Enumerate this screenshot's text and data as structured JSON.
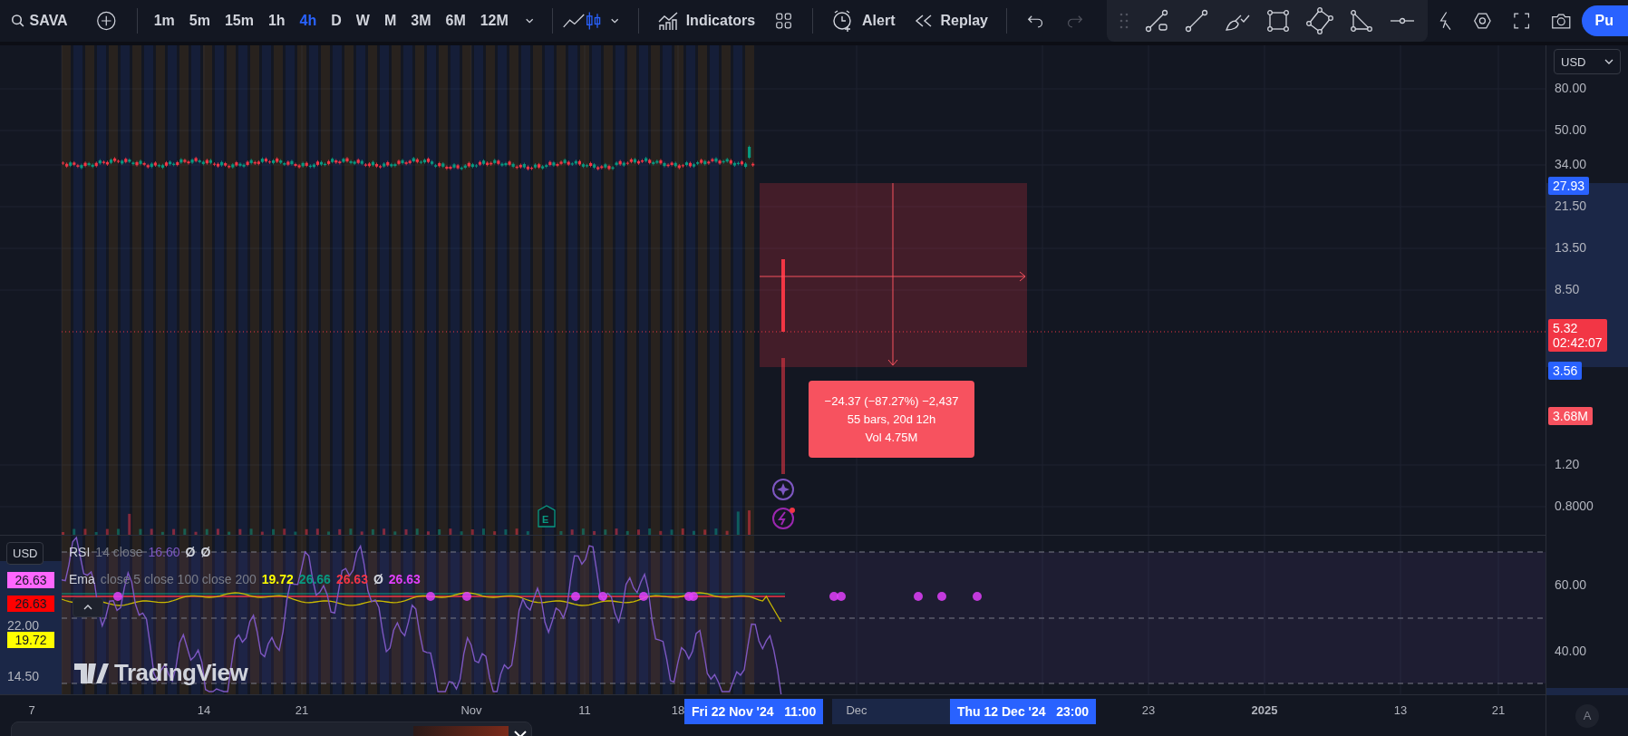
{
  "toolbar": {
    "symbol": "SAVA",
    "intervals": [
      {
        "label": "1m",
        "selected": false
      },
      {
        "label": "5m",
        "selected": false
      },
      {
        "label": "15m",
        "selected": false
      },
      {
        "label": "1h",
        "selected": false
      },
      {
        "label": "4h",
        "selected": true
      },
      {
        "label": "D",
        "selected": false
      },
      {
        "label": "W",
        "selected": false
      },
      {
        "label": "M",
        "selected": false
      },
      {
        "label": "3M",
        "selected": false
      },
      {
        "label": "6M",
        "selected": false
      },
      {
        "label": "12M",
        "selected": false
      }
    ],
    "indicators_label": "Indicators",
    "alert_label": "Alert",
    "replay_label": "Replay",
    "publish_label": "Pu"
  },
  "price_axis": {
    "currency": "USD",
    "ticks": [
      "80.00",
      "50.00",
      "34.00",
      "21.50",
      "13.50",
      "8.50",
      "1.20",
      "0.8000"
    ],
    "labels": [
      {
        "text": "27.93",
        "color": "#2962ff"
      },
      {
        "text": "5.32",
        "subtext": "02:42:07",
        "color": "#f23645"
      },
      {
        "text": "3.56",
        "color": "#2962ff"
      },
      {
        "text": "3.68M",
        "color": "#f7525f"
      }
    ]
  },
  "measure": {
    "lines": [
      "−24.37 (−87.27%) −2,437",
      "55 bars, 20d 12h",
      "Vol 4.75M"
    ]
  },
  "rsi_legend": {
    "name": "RSI",
    "params": "14 close",
    "value": "16.60",
    "extras": [
      "Ø",
      "Ø"
    ]
  },
  "ema_legend": {
    "name": "Ema",
    "params": "close 5 close 100 close 200",
    "values": [
      {
        "text": "19.72",
        "color": "#ffff00"
      },
      {
        "text": "26.66",
        "color": "#089981"
      },
      {
        "text": "26.63",
        "color": "#f23645"
      },
      {
        "text": "Ø",
        "color": "#d1d4dc"
      },
      {
        "text": "26.63",
        "color": "#e040fb"
      }
    ]
  },
  "indicator_left_axis": {
    "currency": "USD",
    "labels": [
      {
        "text": "26.63",
        "color": "#ff66ff"
      },
      {
        "text": "26.63",
        "color": "#ff0000"
      },
      {
        "text": "22.00"
      },
      {
        "text": "19.72",
        "color": "#ffff00"
      },
      {
        "text": "14.50"
      }
    ]
  },
  "indicator_right_axis": {
    "ticks": [
      "60.00",
      "40.00"
    ]
  },
  "logo_text": "TradingView",
  "earnings_badge": "E",
  "time_axis": {
    "ticks": [
      {
        "text": "7",
        "bold": false
      },
      {
        "text": "14",
        "bold": false
      },
      {
        "text": "21",
        "bold": false
      },
      {
        "text": "Nov",
        "bold": false
      },
      {
        "text": "11",
        "bold": false
      },
      {
        "text": "18",
        "bold": false
      },
      {
        "text": "Dec",
        "bold": false
      },
      {
        "text": "23",
        "bold": false
      },
      {
        "text": "2025",
        "bold": true
      },
      {
        "text": "13",
        "bold": false
      },
      {
        "text": "21",
        "bold": false
      }
    ],
    "highlights": [
      "Fri 22 Nov '24   11:00",
      "Thu 12 Dec '24   23:00"
    ],
    "auto_label": "A"
  }
}
